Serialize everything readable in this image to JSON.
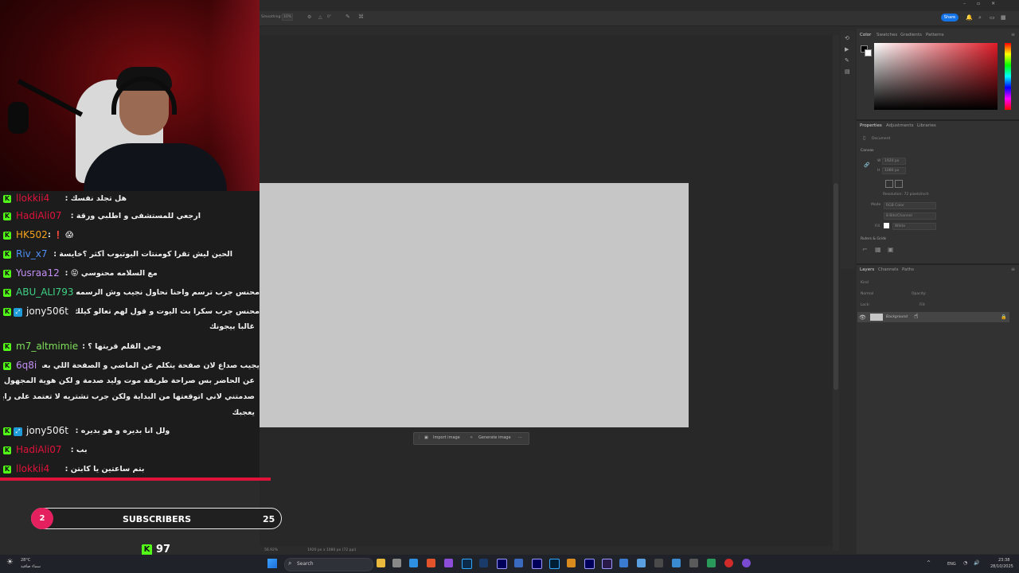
{
  "photoshop": {
    "options_bar": {
      "smoothing_label": "Smoothing:",
      "smoothing_value": "10%",
      "angle_value": "0°"
    },
    "share_label": "Share",
    "color_panel": {
      "tabs": [
        "Color",
        "Swatches",
        "Gradients",
        "Patterns"
      ],
      "accent": "#e01c28"
    },
    "properties_panel": {
      "tabs": [
        "Properties",
        "Adjustments",
        "Libraries"
      ],
      "document_label": "Document",
      "canvas_section": "Canvas",
      "width_value": "1920 px",
      "height_value": "1080 px",
      "resolution": "Resolution: 72 pixels/inch",
      "mode_label": "Mode",
      "mode_value": "RGB Color",
      "depth_value": "8 Bits/Channel",
      "fill_label": "Fill",
      "fill_value": "White",
      "rulers_section": "Rulers & Grids"
    },
    "layers_panel": {
      "tabs": [
        "Layers",
        "Channels",
        "Paths"
      ],
      "kind_placeholder": "Kind",
      "blend_mode": "Normal",
      "opacity_label": "Opacity:",
      "lock_label": "Lock:",
      "fill_label": "Fill:",
      "layer_name": "Background"
    },
    "context_bar": {
      "import_label": "Import image",
      "generate_label": "Generate image",
      "more_label": "···"
    },
    "status": {
      "zoom": "56.92%",
      "doc_size": "1920 px x 1080 px (72 ppi)"
    }
  },
  "chat": [
    {
      "user": "llokkii4",
      "user_color": "#e0123a",
      "badges": [
        "kick"
      ],
      "msg": "هل تجلد نفسك :"
    },
    {
      "user": "HadiAli07",
      "user_color": "#e0123a",
      "badges": [
        "kick"
      ],
      "msg": "ارجعي للمستشفى و اطلبي ورقة :"
    },
    {
      "user": "HK502",
      "user_color": "#f4a21b",
      "badges": [
        "kick"
      ],
      "msg": "😱 ❗ :"
    },
    {
      "user": "Riv_x7",
      "user_color": "#4f8ff7",
      "badges": [
        "kick"
      ],
      "msg": "الحين ليش تقرا كومنتات اليوتيوب أكثر ؟خايسة :"
    },
    {
      "user": "Yusraa12",
      "user_color": "#c48ff5",
      "badges": [
        "kick"
      ],
      "msg": "مع السلامه محنوسي 😝 :"
    },
    {
      "user": "ABU_ALI793",
      "user_color": "#3fd184",
      "badges": [
        "kick"
      ],
      "msg": "محنس جرب ترسم واحنا نحاول نجيب وش الرسمه :"
    },
    {
      "user": "jony506t",
      "user_color": "#f1f1f1",
      "badges": [
        "kick",
        "sub"
      ],
      "msg": "محنس جرب سكرا بث اليوت و قول لهم تعالو كيلك و :",
      "msg2": "غالبا بيجونك"
    },
    {
      "user": "m7_altmimie",
      "user_color": "#7ee05a",
      "badges": [
        "kick"
      ],
      "msg": "وحي القلم قريتها ؟ :"
    },
    {
      "user": "6q8i",
      "user_color": "#c48ff5",
      "badges": [
        "kick"
      ],
      "msg": "يجيب صداع لان صفحة يتكلم عن الماضي و الصفحة اللي بعدها :",
      "msg2": "عن الحاضر بس صراحة طريقة موت وليد صدمة و لكن هوية المجهول ما",
      "msg3": "صدمتني لاني اتوقعتها من البداية ولكن جرب تشتريه لا تعتمد على رايي يمكن",
      "msg4": "يعجبك"
    },
    {
      "user": "jony506t",
      "user_color": "#f1f1f1",
      "badges": [
        "kick",
        "sub"
      ],
      "msg": "ولل انا بديره و هو بديره :"
    },
    {
      "user": "HadiAli07",
      "user_color": "#e0123a",
      "badges": [
        "kick"
      ],
      "msg": "بب :"
    },
    {
      "user": "llokkii4",
      "user_color": "#e0123a",
      "badges": [
        "kick"
      ],
      "msg": "بتم ساعتين يا كابتن :"
    }
  ],
  "subscribers": {
    "current": "2",
    "label": "SUBSCRIBERS",
    "goal": "25"
  },
  "kick_count": "97",
  "taskbar": {
    "search_placeholder": "Search",
    "weather_temp": "28°C",
    "weather_desc": "سماء صافية",
    "lang": "ENG",
    "time": "23:38",
    "date": "28/10/2025"
  }
}
